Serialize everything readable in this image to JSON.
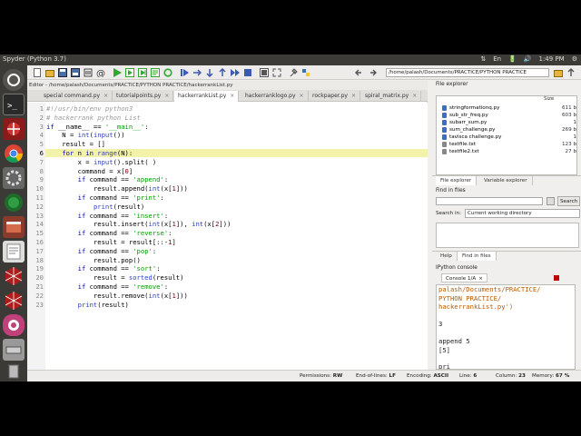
{
  "window": {
    "title": "Spyder (Python 3.7)"
  },
  "tray": {
    "items": [
      "⇅",
      "En",
      "🔋",
      "🔊",
      "1:49 PM",
      "⚙"
    ]
  },
  "toolbar": {
    "working_dir": "/home/palash/Documents/PRACTICE/PYTHON PRACTICE"
  },
  "editor": {
    "title": "Editor - /home/palash/Documents/PRACTICE/PYTHON PRACTICE/hackerrankList.py",
    "tabs": [
      {
        "label": "special command.py"
      },
      {
        "label": "tutorialpoints.py"
      },
      {
        "label": "hackerrankList.py"
      },
      {
        "label": "hackerranklogo.py"
      },
      {
        "label": "rockpaper.py"
      },
      {
        "label": "spiral_matrix.py"
      }
    ],
    "line_numbers": [
      "1",
      "2",
      "3",
      "4",
      "5",
      "6",
      "7",
      "8",
      "9",
      "10",
      "11",
      "12",
      "13",
      "14",
      "15",
      "16",
      "17",
      "18",
      "19",
      "20",
      "21",
      "22",
      "23"
    ]
  },
  "file_explorer": {
    "header": "File explorer",
    "col_size": "Size",
    "files": [
      {
        "name": "stringformationq.py",
        "size": "611 b"
      },
      {
        "name": "sub_str_freq.py",
        "size": "603 b"
      },
      {
        "name": "subarr_sum.py",
        "size": "1"
      },
      {
        "name": "sum_challenge.py",
        "size": "269 b"
      },
      {
        "name": "tavisca challenge.py",
        "size": "1"
      },
      {
        "name": "textfile.txt",
        "size": "123 b"
      },
      {
        "name": "textfile2.txt",
        "size": "27 b"
      }
    ],
    "tab_files": "File explorer",
    "tab_vars": "Variable explorer"
  },
  "find": {
    "header": "Find in files",
    "search_btn": "Search",
    "search_in_label": "Search in:",
    "search_in_value": "Current working directory",
    "tab_help": "Help",
    "tab_find": "Find in files"
  },
  "console": {
    "header": "IPython console",
    "tab": "Console 1/A",
    "lines": [
      "palash/Documents/PRACTICE/",
      "PYTHON PRACTICE/",
      "hackerrankList.py')",
      "",
      "3",
      "",
      "append 5",
      "[5]",
      "",
      "pri"
    ]
  },
  "status": {
    "permissions_label": "Permissions:",
    "permissions": "RW",
    "eol_label": "End-of-lines:",
    "eol": "LF",
    "encoding_label": "Encoding:",
    "encoding": "ASCII",
    "line_label": "Line:",
    "line": "6",
    "col_label": "Column:",
    "col": "23",
    "mem_label": "Memory:",
    "mem": "67 %"
  },
  "colors": {
    "topbar": "#3c3b37",
    "launcher": "#3b3a37",
    "run_green": "#2ea82e",
    "stop_red": "#c00000"
  }
}
